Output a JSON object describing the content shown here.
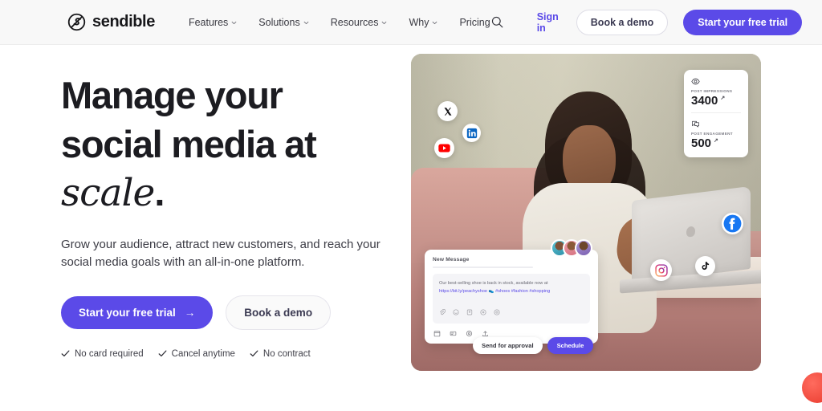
{
  "header": {
    "brand_name": "sendible",
    "logo_icon": "sendible-circle-logo",
    "nav": [
      {
        "label": "Features",
        "has_dropdown": true
      },
      {
        "label": "Solutions",
        "has_dropdown": true
      },
      {
        "label": "Resources",
        "has_dropdown": true
      },
      {
        "label": "Why",
        "has_dropdown": true
      },
      {
        "label": "Pricing",
        "has_dropdown": false
      }
    ],
    "search_icon": "search-icon",
    "sign_in": "Sign in",
    "book_demo": "Book a demo",
    "free_trial": "Start your free trial"
  },
  "hero": {
    "headline_line1": "Manage your",
    "headline_line2": "social media at",
    "headline_italic": "scale",
    "headline_period": ".",
    "subhead_line1": "Grow your audience, attract new customers, and reach",
    "subhead_line2": "your social media goals with an all-in-one platform.",
    "cta_primary": "Start your free trial",
    "cta_primary_arrow": "→",
    "cta_secondary": "Book a demo",
    "features": [
      {
        "label": "No card required"
      },
      {
        "label": "Cancel anytime"
      },
      {
        "label": "No contract"
      }
    ]
  },
  "hero_image": {
    "social_badges": [
      {
        "name": "x-twitter-icon",
        "platform": "X"
      },
      {
        "name": "linkedin-icon",
        "platform": "LinkedIn"
      },
      {
        "name": "youtube-icon",
        "platform": "YouTube"
      },
      {
        "name": "facebook-icon",
        "platform": "Facebook"
      },
      {
        "name": "tiktok-icon",
        "platform": "TikTok"
      },
      {
        "name": "instagram-icon",
        "platform": "Instagram"
      }
    ],
    "stats": [
      {
        "icon": "eye-icon",
        "label": "POST IMPRESSIONS",
        "value": "3400",
        "trend": "↗"
      },
      {
        "icon": "engagement-icon",
        "label": "POST ENGAGEMENT",
        "value": "500",
        "trend": "↗"
      }
    ],
    "composer": {
      "title": "New Message",
      "text_before_link": "Our best-selling shoe is back in stock, available now at",
      "link": "https://bit.ly/peachyshoe",
      "emoji": "👟",
      "hashtags": "#shoes #fashion #shopping",
      "toolbar_icons": [
        "attachment-icon",
        "emoji-icon",
        "image-icon",
        "location-icon",
        "tag-icon"
      ],
      "footer_icons": [
        "calendar-icon",
        "queue-icon",
        "settings-icon",
        "upload-icon"
      ],
      "send_for_approval": "Send for approval",
      "schedule": "Schedule",
      "avatar_count": 3
    }
  },
  "widgets": {
    "chat_bubble": "chat-widget"
  },
  "colors": {
    "accent": "#5b4ae8",
    "header_bg": "#f8f8f8",
    "text_dark": "#1c1c21",
    "text_body": "#3c3c45"
  }
}
